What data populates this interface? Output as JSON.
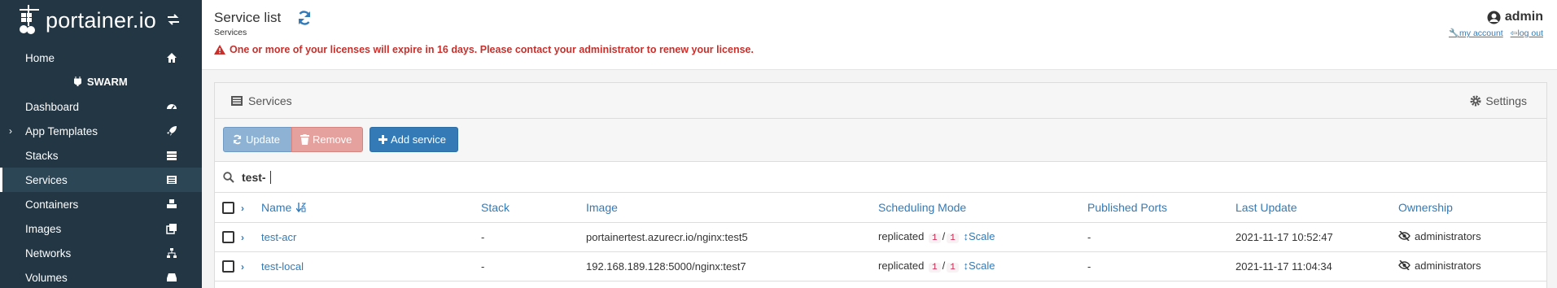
{
  "sidebar": {
    "logo_text": "portainer.io",
    "home": "Home",
    "section": "SWARM",
    "items": [
      {
        "label": "Dashboard"
      },
      {
        "label": "App Templates"
      },
      {
        "label": "Stacks"
      },
      {
        "label": "Services"
      },
      {
        "label": "Containers"
      },
      {
        "label": "Images"
      },
      {
        "label": "Networks"
      },
      {
        "label": "Volumes"
      }
    ]
  },
  "header": {
    "title": "Service list",
    "breadcrumb": "Services",
    "warning": "One or more of your licenses will expire in 16 days. Please contact your administrator to renew your license.",
    "user": "admin",
    "my_account": "my account",
    "log_out": "log out"
  },
  "panel": {
    "title": "Services",
    "settings": "Settings",
    "buttons": {
      "update": "Update",
      "remove": "Remove",
      "add": "Add service"
    },
    "search_value": "test-"
  },
  "table": {
    "columns": [
      "Name",
      "Stack",
      "Image",
      "Scheduling Mode",
      "Published Ports",
      "Last Update",
      "Ownership"
    ],
    "rows": [
      {
        "name": "test-acr",
        "stack": "-",
        "image": "portainertest.azurecr.io/nginx:test5",
        "mode": "replicated",
        "running": "1",
        "sep": "/",
        "desired": "1",
        "scale": "Scale",
        "ports": "-",
        "updated": "2021-11-17 10:52:47",
        "ownership": "administrators"
      },
      {
        "name": "test-local",
        "stack": "-",
        "image": "192.168.189.128:5000/nginx:test7",
        "mode": "replicated",
        "running": "1",
        "sep": "/",
        "desired": "1",
        "scale": "Scale",
        "ports": "-",
        "updated": "2021-11-17 11:04:34",
        "ownership": "administrators"
      }
    ]
  },
  "colors": {
    "sidebar_bg": "#233644",
    "link": "#337ab7",
    "warning": "#c9302c",
    "primary": "#337ab7"
  }
}
